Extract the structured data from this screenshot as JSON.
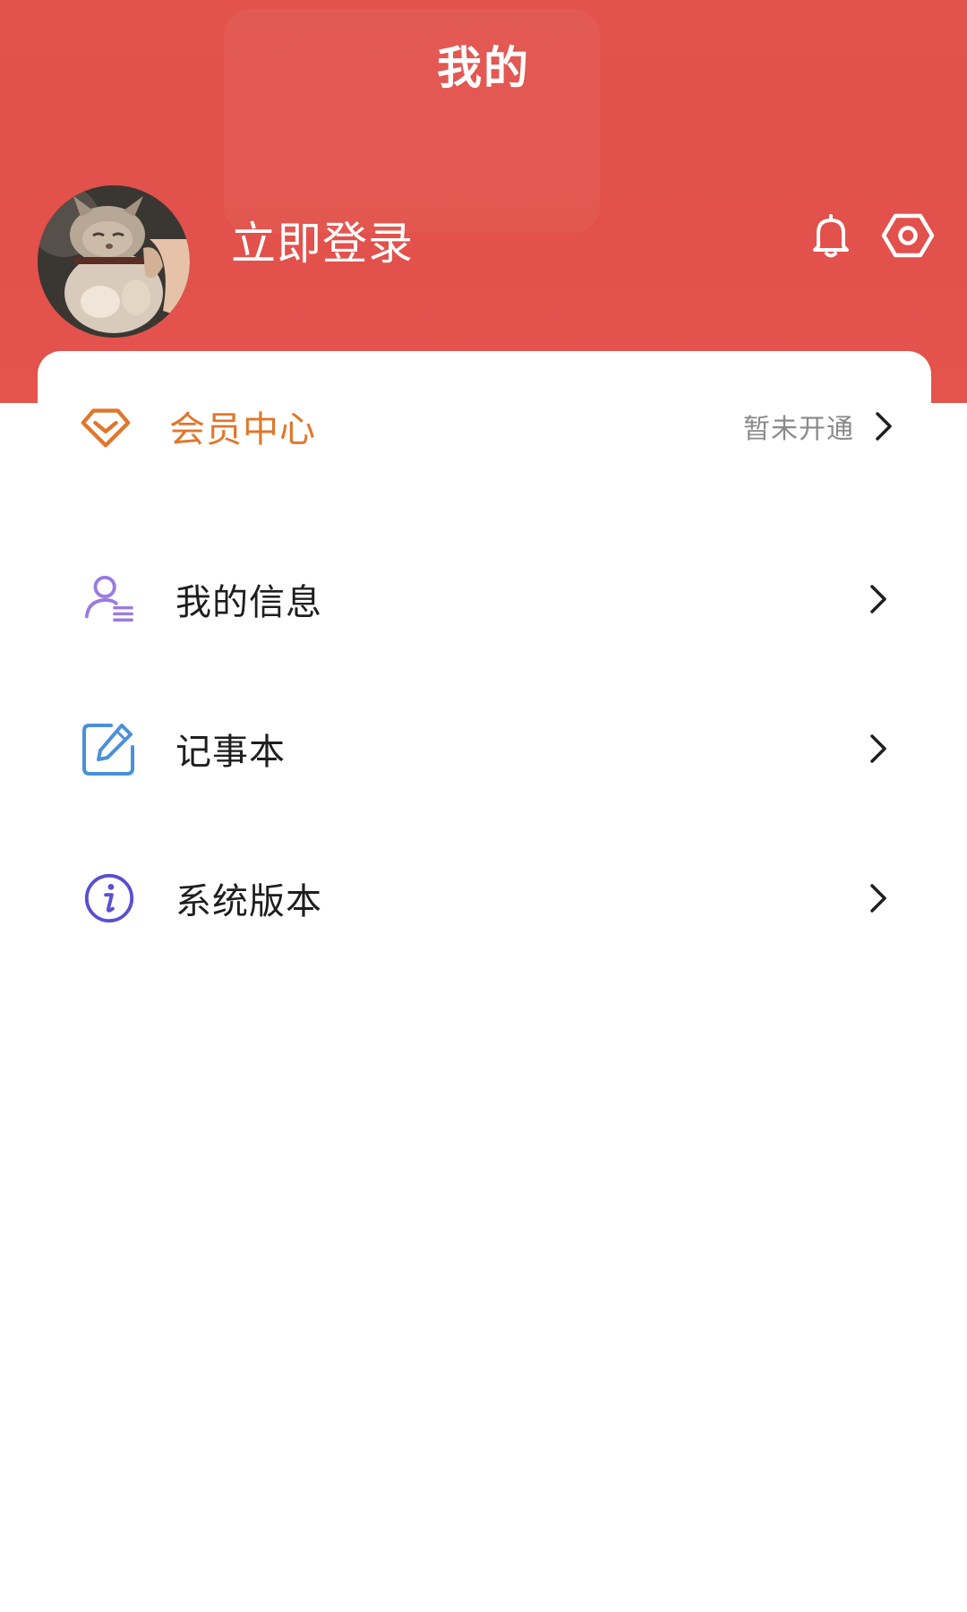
{
  "header": {
    "title": "我的",
    "login_label": "立即登录",
    "bg_color": "#e2534d",
    "icons": [
      "bell-icon",
      "settings-icon"
    ]
  },
  "vip": {
    "label": "会员中心",
    "status": "暂未开通",
    "color": "#e0762b"
  },
  "menu": {
    "items": [
      {
        "label": "我的信息",
        "icon": "user-info-icon",
        "icon_color": "#9b7be0"
      },
      {
        "label": "记事本",
        "icon": "notepad-edit-icon",
        "icon_color": "#4a90d9"
      },
      {
        "label": "系统版本",
        "icon": "info-icon",
        "icon_color": "#5a4fcf"
      }
    ]
  }
}
